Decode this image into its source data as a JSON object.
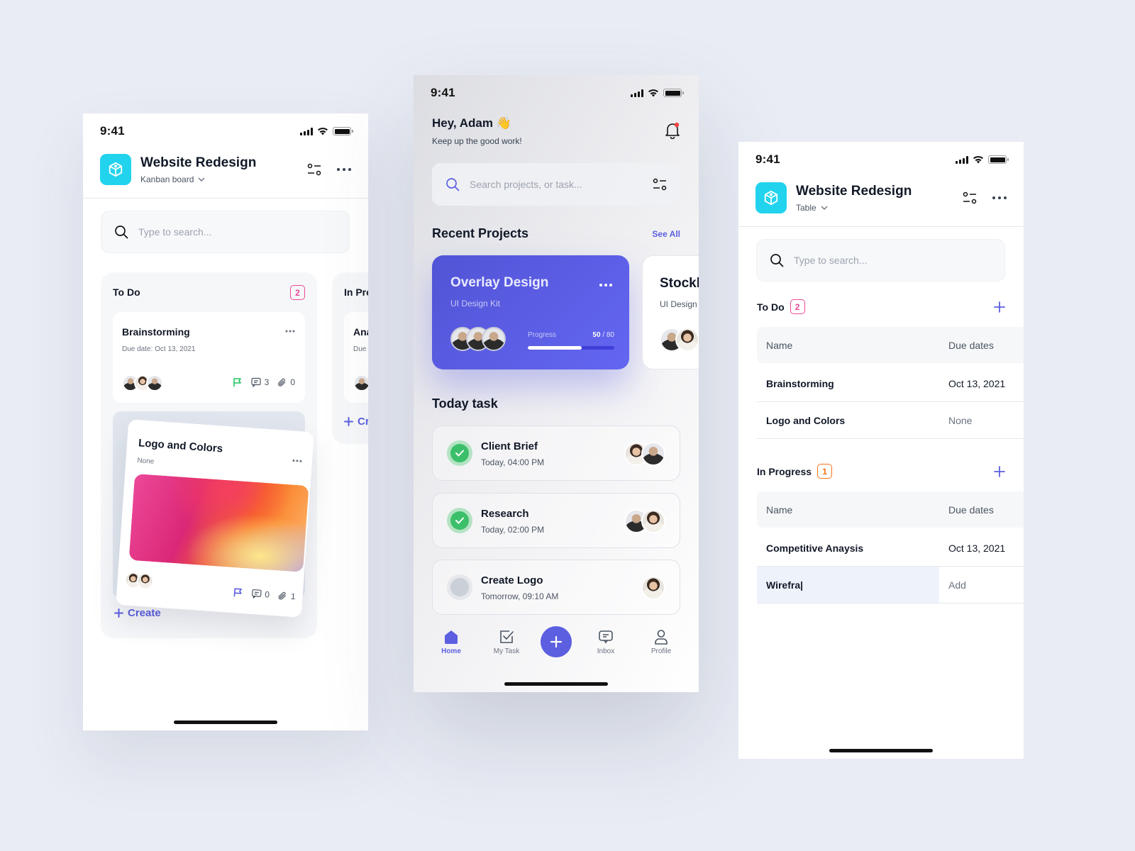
{
  "status": {
    "time": "9:41"
  },
  "kanban_screen": {
    "project_title": "Website Redesign",
    "view_label": "Kanban board",
    "search_placeholder": "Type to search...",
    "columns": [
      {
        "title": "To Do",
        "count": "2",
        "cards": [
          {
            "title": "Brainstorming",
            "due": "Due date: Oct 13, 2021",
            "flag_color": "#22c55e",
            "comments": "3",
            "attachments": "0"
          },
          {
            "title": "Logo and Colors",
            "due": "None",
            "flag_color": "#5b5fe0",
            "comments": "0",
            "attachments": "1"
          }
        ],
        "create_label": "Create"
      },
      {
        "title": "In Progress",
        "cards": [
          {
            "title": "Analysis",
            "due": "Due date"
          }
        ],
        "create_label": "Create"
      }
    ]
  },
  "home_screen": {
    "greeting": "Hey, Adam 👋",
    "subtitle": "Keep up the good work!",
    "search_placeholder": "Search projects, or task...",
    "recent_projects_title": "Recent Projects",
    "see_all_label": "See All",
    "projects": [
      {
        "title": "Overlay Design",
        "subtitle": "UI Design Kit",
        "progress_label": "Progress",
        "progress_done": "50",
        "progress_total": "/ 80",
        "progress_fraction": 0.625
      },
      {
        "title": "Stockholm",
        "subtitle": "UI Design Kit"
      }
    ],
    "today_task_title": "Today task",
    "tasks": [
      {
        "title": "Client Brief",
        "time": "Today, 04:00 PM",
        "done": true
      },
      {
        "title": "Research",
        "time": "Today, 02:00 PM",
        "done": true
      },
      {
        "title": "Create Logo",
        "time": "Tomorrow, 09:10 AM",
        "done": false
      }
    ],
    "tabs": [
      {
        "label": "Home",
        "icon": "home-icon",
        "active": true
      },
      {
        "label": "My Task",
        "icon": "checkbox-icon"
      },
      {
        "label": "Inbox",
        "icon": "chat-icon"
      },
      {
        "label": "Profile",
        "icon": "user-icon"
      }
    ],
    "accent_color": "#5b5fe0"
  },
  "table_screen": {
    "project_title": "Website Redesign",
    "view_label": "Table",
    "search_placeholder": "Type to search...",
    "groups": [
      {
        "title": "To Do",
        "count": "2",
        "badge_color": "#ec4899",
        "headers": [
          "Name",
          "Due dates"
        ],
        "rows": [
          {
            "name": "Brainstorming",
            "due": "Oct 13, 2021"
          },
          {
            "name": "Logo and Colors",
            "due": "None"
          }
        ]
      },
      {
        "title": "In Progress",
        "count": "1",
        "badge_color": "#f97316",
        "headers": [
          "Name",
          "Due dates"
        ],
        "rows": [
          {
            "name": "Competitive Anaysis",
            "due": "Oct 13, 2021"
          },
          {
            "name": "Wirefra|",
            "due": "Add"
          }
        ]
      }
    ]
  }
}
